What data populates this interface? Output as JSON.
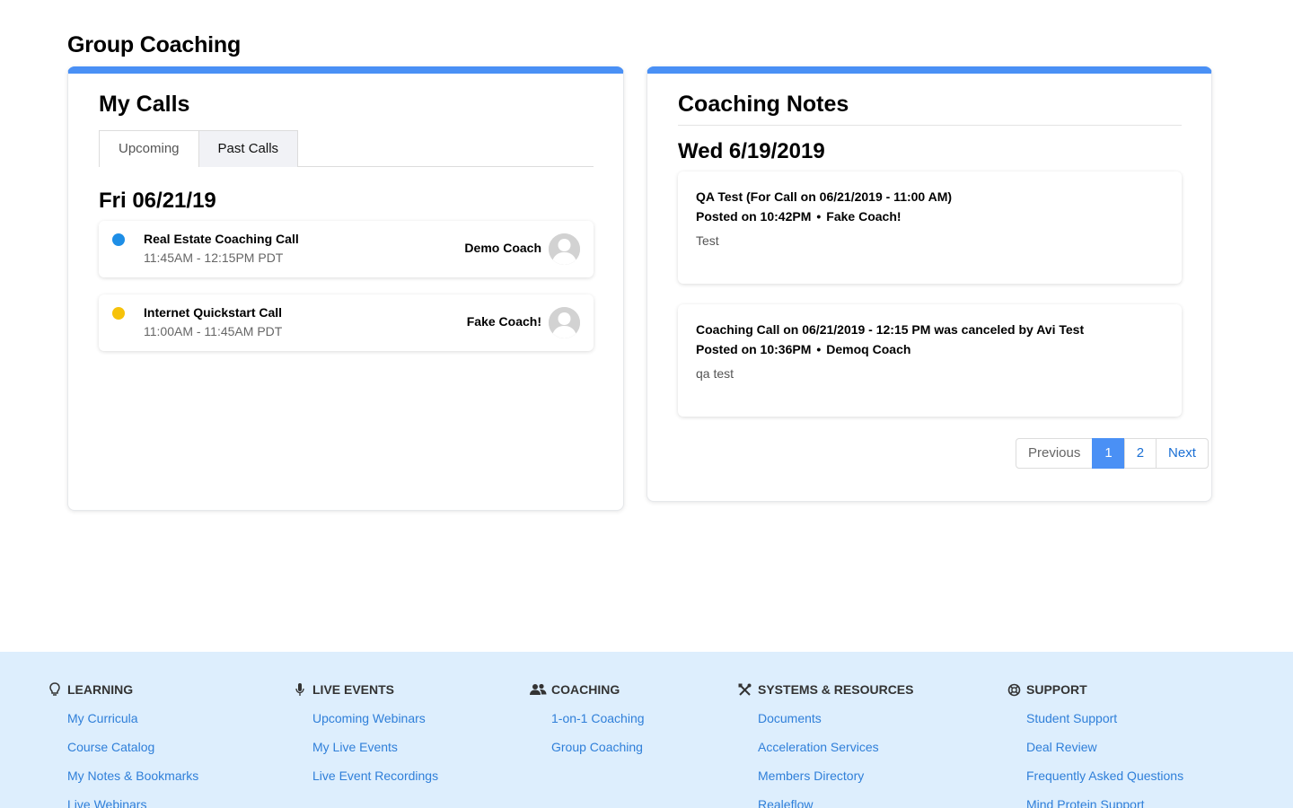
{
  "page": {
    "title": "Group Coaching"
  },
  "my_calls": {
    "heading": "My Calls",
    "tabs": [
      {
        "label": "Upcoming",
        "active": false
      },
      {
        "label": "Past Calls",
        "active": true
      }
    ],
    "date": "Fri 06/21/19",
    "calls": [
      {
        "title": "Real Estate Coaching Call",
        "time": "11:45AM - 12:15PM PDT",
        "coach": "Demo Coach",
        "dot_color": "#1e8ee6"
      },
      {
        "title": "Internet Quickstart Call",
        "time": "11:00AM - 11:45AM PDT",
        "coach": "Fake Coach!",
        "dot_color": "#f6c20a"
      }
    ]
  },
  "coaching_notes": {
    "heading": "Coaching Notes",
    "date": "Wed 6/19/2019",
    "notes": [
      {
        "title": "QA Test (For Call on 06/21/2019 - 11:00 AM)",
        "posted": "Posted on 10:42PM",
        "bullet": "•",
        "author": "Fake Coach!",
        "body": "Test"
      },
      {
        "title": "Coaching Call on 06/21/2019 - 12:15 PM was canceled by Avi Test",
        "posted": "Posted on 10:36PM",
        "bullet": "•",
        "author": "Demoq Coach",
        "body": "qa test"
      }
    ],
    "pagination": {
      "previous": "Previous",
      "pages": [
        "1",
        "2"
      ],
      "current": "1",
      "next": "Next"
    }
  },
  "footer": {
    "columns": [
      {
        "heading": "LEARNING",
        "icon": "lightbulb-icon",
        "links": [
          "My Curricula",
          "Course Catalog",
          "My Notes & Bookmarks",
          "Live Webinars"
        ]
      },
      {
        "heading": "LIVE EVENTS",
        "icon": "microphone-icon",
        "links": [
          "Upcoming Webinars",
          "My Live Events",
          "Live Event Recordings"
        ]
      },
      {
        "heading": "COACHING",
        "icon": "users-icon",
        "links": [
          "1-on-1 Coaching",
          "Group Coaching"
        ]
      },
      {
        "heading": "SYSTEMS & RESOURCES",
        "icon": "tools-icon",
        "links": [
          "Documents",
          "Acceleration Services",
          "Members Directory",
          "Realeflow"
        ]
      },
      {
        "heading": "SUPPORT",
        "icon": "lifebuoy-icon",
        "links": [
          "Student Support",
          "Deal Review",
          "Frequently Asked Questions",
          "Mind Protein Support"
        ]
      }
    ]
  },
  "colors": {
    "accent": "#4a90f5",
    "link": "#2f7fd9",
    "footer_bg": "#ddeefd"
  }
}
